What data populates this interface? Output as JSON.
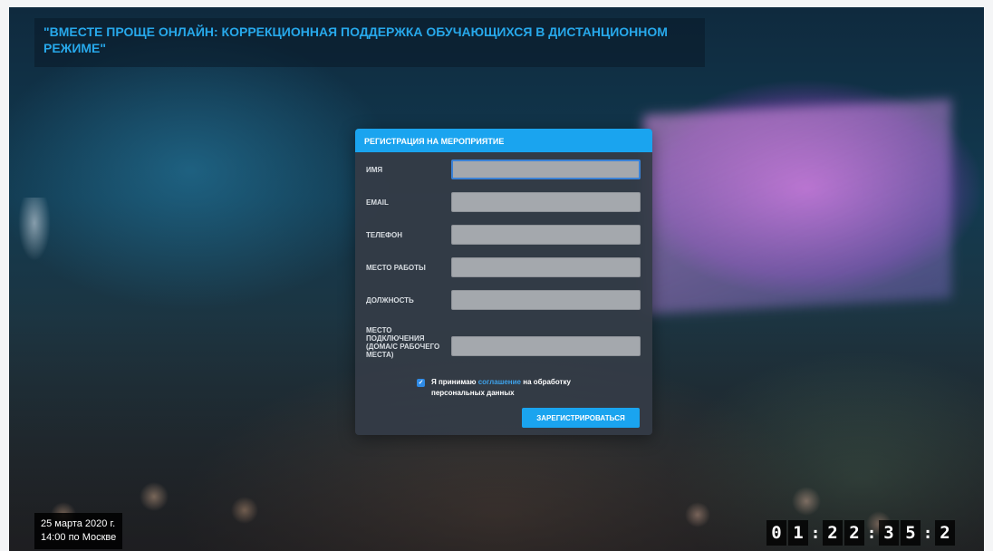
{
  "event": {
    "title": "\"ВМЕСТЕ ПРОЩЕ ОНЛАЙН: КОРРЕКЦИОННАЯ ПОДДЕРЖКА ОБУЧАЮЩИХСЯ В ДИСТАНЦИОННОМ РЕЖИМЕ\""
  },
  "form": {
    "header": "РЕГИСТРАЦИЯ НА МЕРОПРИЯТИЕ",
    "fields": [
      {
        "label": "ИМЯ",
        "value": ""
      },
      {
        "label": "EMAIL",
        "value": ""
      },
      {
        "label": "ТЕЛЕФОН",
        "value": ""
      },
      {
        "label": "МЕСТО РАБОТЫ",
        "value": ""
      },
      {
        "label": "ДОЛЖНОСТЬ",
        "value": ""
      },
      {
        "label": "МЕСТО ПОДКЛЮЧЕНИЯ (ДОМА/С РАБОЧЕГО МЕСТА)",
        "value": ""
      }
    ],
    "agreement": {
      "prefix": "Я принимаю",
      "link": "соглашение",
      "suffix": "на обработку персональных данных",
      "checked": true
    },
    "submit_label": "ЗАРЕГИСТРИРОВАТЬСЯ"
  },
  "schedule": {
    "date": "25 марта 2020 г.",
    "time": "14:00 по Москве"
  },
  "countdown": {
    "digits": [
      "0",
      "1",
      ":",
      "2",
      "2",
      ":",
      "3",
      "5",
      ":",
      "2"
    ]
  },
  "colors": {
    "accent": "#1aa4ef",
    "title": "#27a8ea",
    "panel": "#343c46",
    "input": "#a4a8ad"
  }
}
